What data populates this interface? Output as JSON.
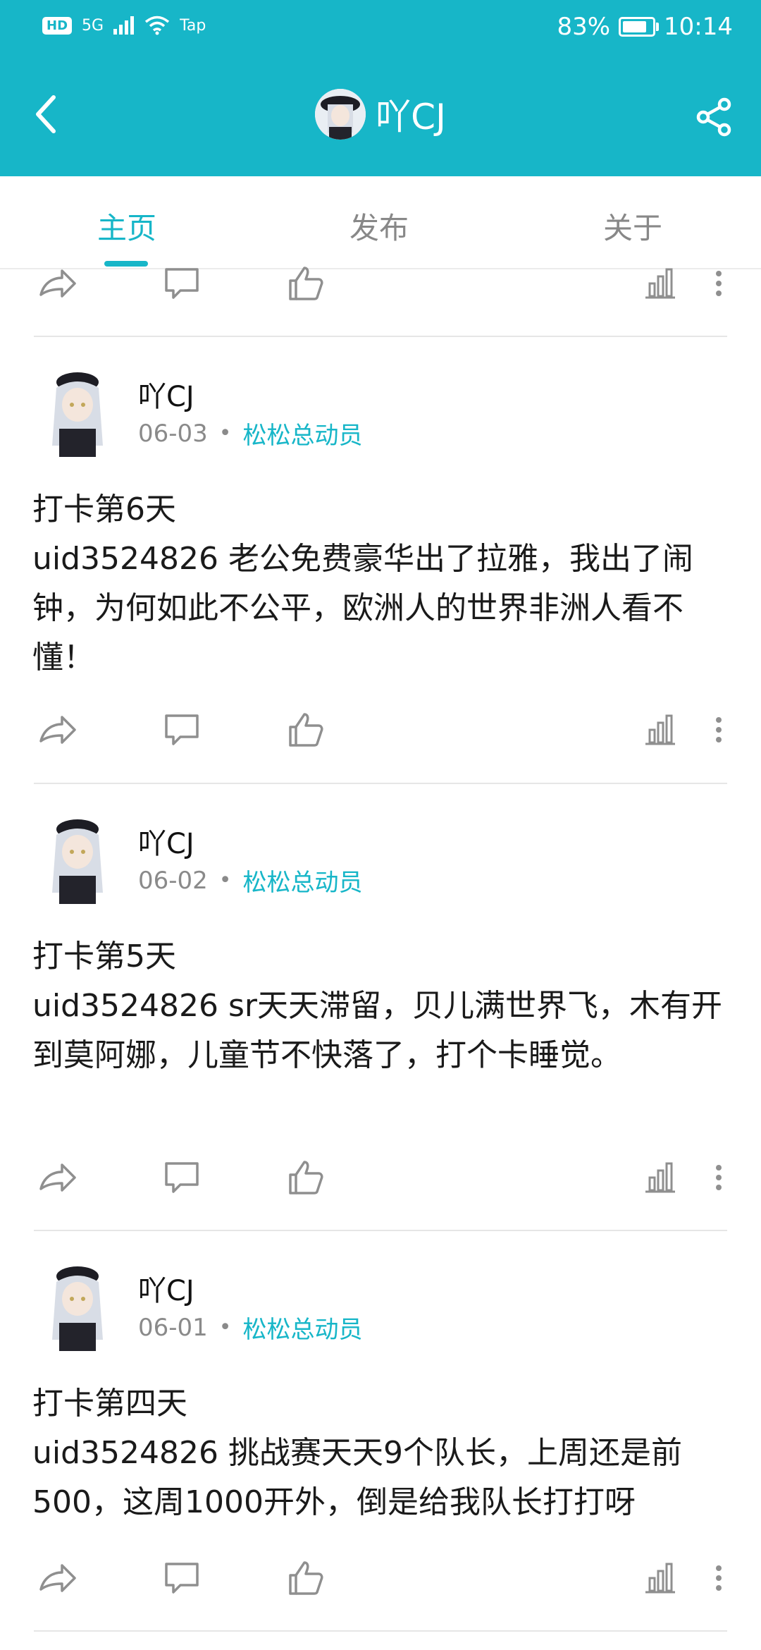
{
  "status": {
    "network": "5G",
    "carrier_tag": "Tap",
    "battery": "83%",
    "battery_level": 0.83,
    "time": "10:14"
  },
  "header": {
    "title": "吖CJ"
  },
  "tabs": [
    {
      "label": "主页",
      "active": true
    },
    {
      "label": "发布",
      "active": false
    },
    {
      "label": "关于",
      "active": false
    }
  ],
  "posts": [
    {
      "username": "吖CJ",
      "date": "06-03",
      "group": "松松总动员",
      "title": "打卡第6天",
      "text": "uid3524826 老公免费豪华出了拉雅，我出了闹钟，为何如此不公平，欧洲人的世界非洲人看不懂！"
    },
    {
      "username": "吖CJ",
      "date": "06-02",
      "group": "松松总动员",
      "title": "打卡第5天",
      "text": "uid3524826 sr天天滞留，贝儿满世界飞，木有开到莫阿娜，儿童节不快落了，打个卡睡觉。"
    },
    {
      "username": "吖CJ",
      "date": "06-01",
      "group": "松松总动员",
      "title": "打卡第四天",
      "text": "uid3524826 挑战赛天天9个队长，上周还是前500，这周1000开外，倒是给我队长打打呀"
    }
  ],
  "icons": {
    "accent": "#17b6c8",
    "icon_gray": "#8f8f8f"
  }
}
